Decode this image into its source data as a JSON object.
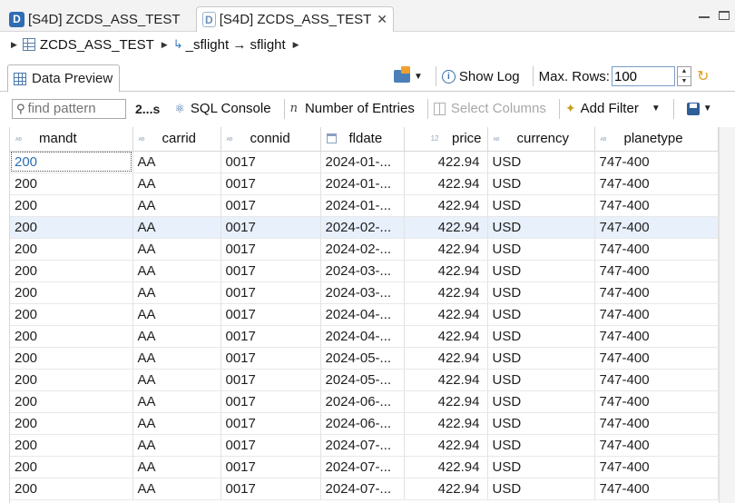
{
  "tabs": [
    {
      "icon_letter": "D",
      "label": "[S4D] ZCDS_ASS_TEST"
    },
    {
      "icon_letter": "D",
      "label": "[S4D] ZCDS_ASS_TEST",
      "close": "✕"
    }
  ],
  "breadcrumb": {
    "item1": "ZCDS_ASS_TEST",
    "item2": "_sflight → sflight"
  },
  "view_tab": {
    "label": "Data Preview"
  },
  "toolbar": {
    "show_log": "Show Log",
    "max_rows_label": "Max. Rows:",
    "max_rows_value": "100"
  },
  "filterbar": {
    "find_placeholder": "find pattern",
    "count": "2...s",
    "sql_console": "SQL Console",
    "number_of_entries": "Number of Entries",
    "select_columns": "Select Columns",
    "add_filter": "Add Filter"
  },
  "table": {
    "columns": [
      "mandt",
      "carrid",
      "connid",
      "fldate",
      "price",
      "currency",
      "planetype"
    ],
    "numeric_tag": "12",
    "rows": [
      [
        "200",
        "AA",
        "0017",
        "2024-01-...",
        "422.94",
        "USD",
        "747-400"
      ],
      [
        "200",
        "AA",
        "0017",
        "2024-01-...",
        "422.94",
        "USD",
        "747-400"
      ],
      [
        "200",
        "AA",
        "0017",
        "2024-01-...",
        "422.94",
        "USD",
        "747-400"
      ],
      [
        "200",
        "AA",
        "0017",
        "2024-02-...",
        "422.94",
        "USD",
        "747-400"
      ],
      [
        "200",
        "AA",
        "0017",
        "2024-02-...",
        "422.94",
        "USD",
        "747-400"
      ],
      [
        "200",
        "AA",
        "0017",
        "2024-03-...",
        "422.94",
        "USD",
        "747-400"
      ],
      [
        "200",
        "AA",
        "0017",
        "2024-03-...",
        "422.94",
        "USD",
        "747-400"
      ],
      [
        "200",
        "AA",
        "0017",
        "2024-04-...",
        "422.94",
        "USD",
        "747-400"
      ],
      [
        "200",
        "AA",
        "0017",
        "2024-04-...",
        "422.94",
        "USD",
        "747-400"
      ],
      [
        "200",
        "AA",
        "0017",
        "2024-05-...",
        "422.94",
        "USD",
        "747-400"
      ],
      [
        "200",
        "AA",
        "0017",
        "2024-05-...",
        "422.94",
        "USD",
        "747-400"
      ],
      [
        "200",
        "AA",
        "0017",
        "2024-06-...",
        "422.94",
        "USD",
        "747-400"
      ],
      [
        "200",
        "AA",
        "0017",
        "2024-06-...",
        "422.94",
        "USD",
        "747-400"
      ],
      [
        "200",
        "AA",
        "0017",
        "2024-07-...",
        "422.94",
        "USD",
        "747-400"
      ],
      [
        "200",
        "AA",
        "0017",
        "2024-07-...",
        "422.94",
        "USD",
        "747-400"
      ],
      [
        "200",
        "AA",
        "0017",
        "2024-07-...",
        "422.94",
        "USD",
        "747-400"
      ]
    ],
    "selected_row": 3
  }
}
